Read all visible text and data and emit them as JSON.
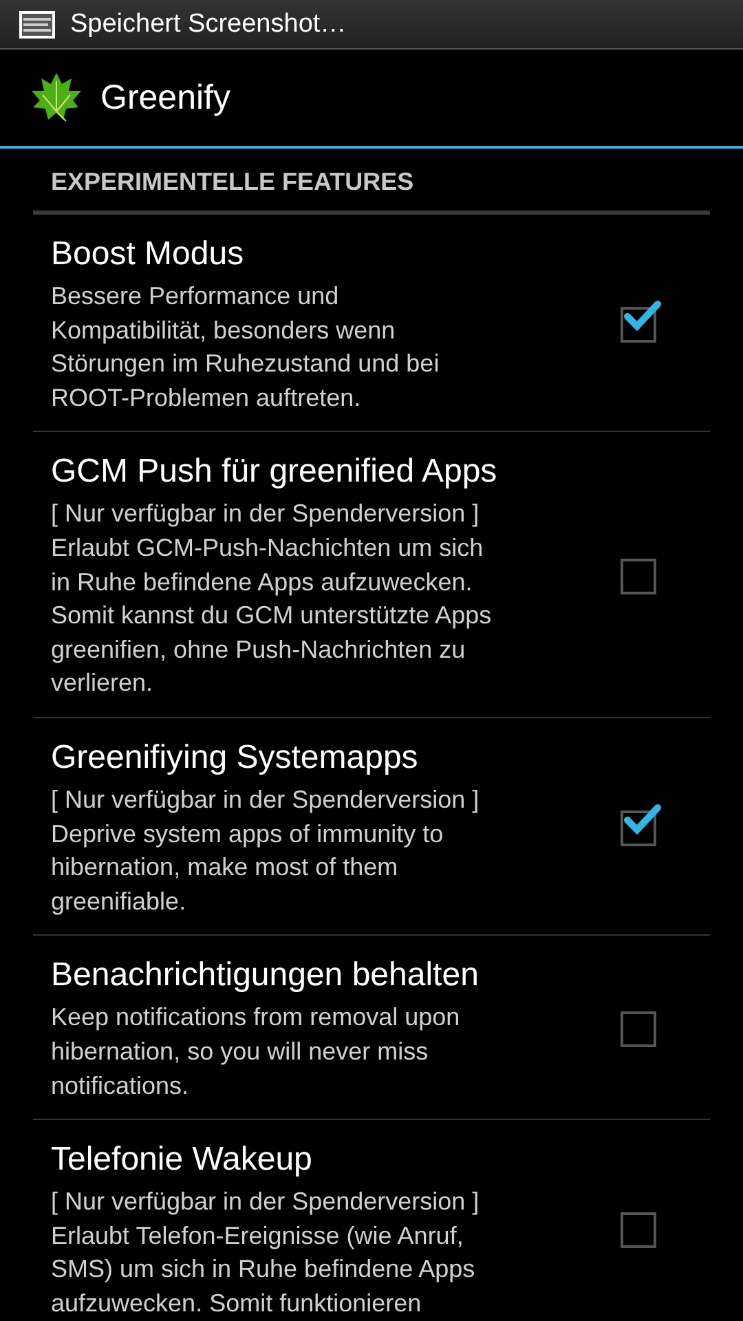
{
  "status_bar": {
    "notification": "Speichert Screenshot…"
  },
  "action_bar": {
    "title": "Greenify"
  },
  "section": {
    "title": "EXPERIMENTELLE FEATURES"
  },
  "preferences": [
    {
      "title": "Boost Modus",
      "summary_lines": [
        "Bessere Performance und",
        "Kompatibilität, besonders wenn",
        "Störungen im Ruhezustand und bei",
        "ROOT-Problemen auftreten."
      ],
      "checked": true
    },
    {
      "title": "GCM Push für greenified Apps",
      "summary_lines": [
        "[ Nur verfügbar in der Spenderversion ]",
        "Erlaubt GCM-Push-Nachichten um sich",
        "in Ruhe befindene Apps aufzuwecken.",
        "Somit kannst du GCM unterstützte Apps",
        "greenifien, ohne Push-Nachrichten zu",
        "verlieren."
      ],
      "checked": false
    },
    {
      "title": "Greenifiying Systemapps",
      "summary_lines": [
        "[ Nur verfügbar in der Spenderversion ]",
        "Deprive system apps of immunity to",
        "hibernation, make most of them",
        "greenifiable."
      ],
      "checked": true
    },
    {
      "title": "Benachrichtigungen behalten",
      "summary_lines": [
        "Keep notifications from removal upon",
        "hibernation, so you will never miss",
        "notifications."
      ],
      "checked": false
    },
    {
      "title": "Telefonie Wakeup",
      "summary_lines": [
        "[ Nur verfügbar in der Spenderversion ]",
        "Erlaubt Telefon-Ereignisse (wie Anruf,",
        "SMS) um sich in Ruhe befindene Apps",
        "aufzuwecken. Somit funktionieren"
      ],
      "checked": false
    }
  ]
}
